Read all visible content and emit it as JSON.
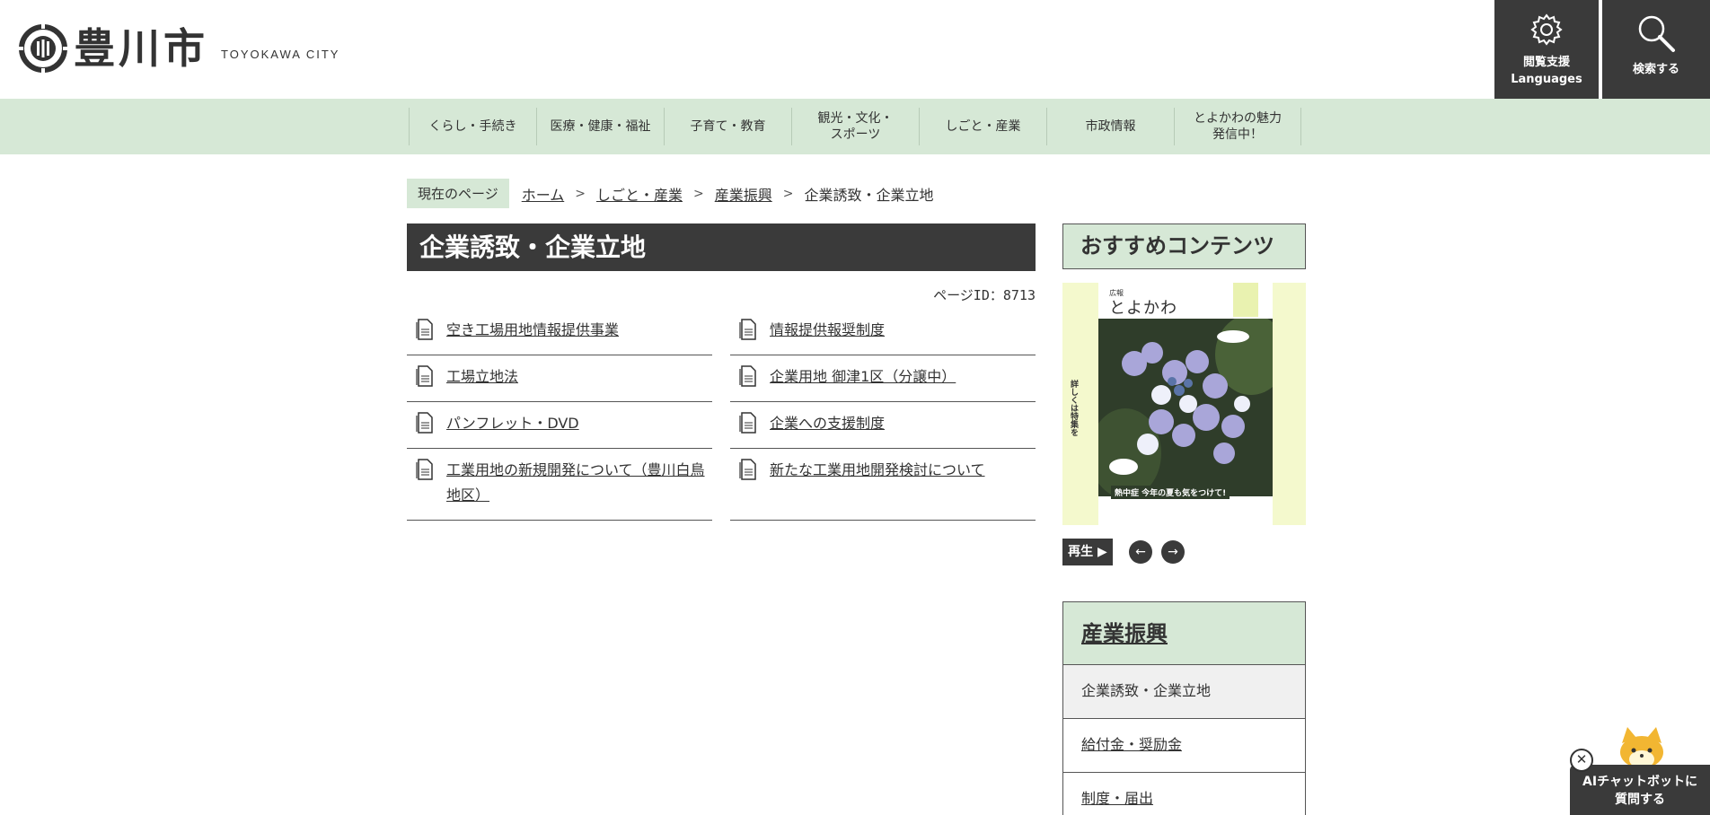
{
  "header": {
    "logo_name": "豊川市",
    "logo_en": "TOYOKAWA CITY",
    "lang_label_1": "閲覧支援",
    "lang_label_2": "Languages",
    "search_label": "検索する"
  },
  "gnav": {
    "items": [
      {
        "line1": "くらし・手続き",
        "line2": ""
      },
      {
        "line1": "医療・健康・福祉",
        "line2": ""
      },
      {
        "line1": "子育て・教育",
        "line2": ""
      },
      {
        "line1": "観光・文化・",
        "line2": "スポーツ"
      },
      {
        "line1": "しごと・産業",
        "line2": ""
      },
      {
        "line1": "市政情報",
        "line2": ""
      },
      {
        "line1": "とよかわの魅力",
        "line2": "発信中！"
      }
    ]
  },
  "breadcrumb": {
    "label": "現在のページ",
    "items": [
      "ホーム",
      "しごと・産業",
      "産業振興"
    ],
    "separator": ">",
    "current": "企業誘致・企業立地"
  },
  "main": {
    "title": "企業誘致・企業立地",
    "page_id": "ページID：8713",
    "links_left": [
      "空き工場用地情報提供事業",
      "工場立地法",
      "パンフレット・DVD",
      "工業用地の新規開発について（豊川白鳥地区）"
    ],
    "links_right": [
      "情報提供報奨制度",
      "企業用地 御津1区（分譲中）",
      "企業への支援制度",
      "新たな工業用地開発検討について"
    ]
  },
  "sidebar": {
    "recommended_title": "おすすめコンテンツ",
    "banner": {
      "mag_small": "広報",
      "mag_title": "とよかわ",
      "side_text_1": "詳しくは",
      "side_text_2": "特集を",
      "caption": "熱中症 今年の夏も気をつけて!"
    },
    "play_label": "再生 ▶",
    "prev_label": "←",
    "next_label": "→",
    "menu_title": "産業振興",
    "menu_items": [
      "企業誘致・企業立地",
      "給付金・奨励金",
      "制度・届出"
    ]
  },
  "chatbot": {
    "close": "✕",
    "line1": "AIチャットボットに",
    "line2": "質問する"
  },
  "colors": {
    "nav_bg": "#d6e8d6",
    "dark": "#3a3a3a",
    "banner_bg": "#f4f9cd"
  }
}
